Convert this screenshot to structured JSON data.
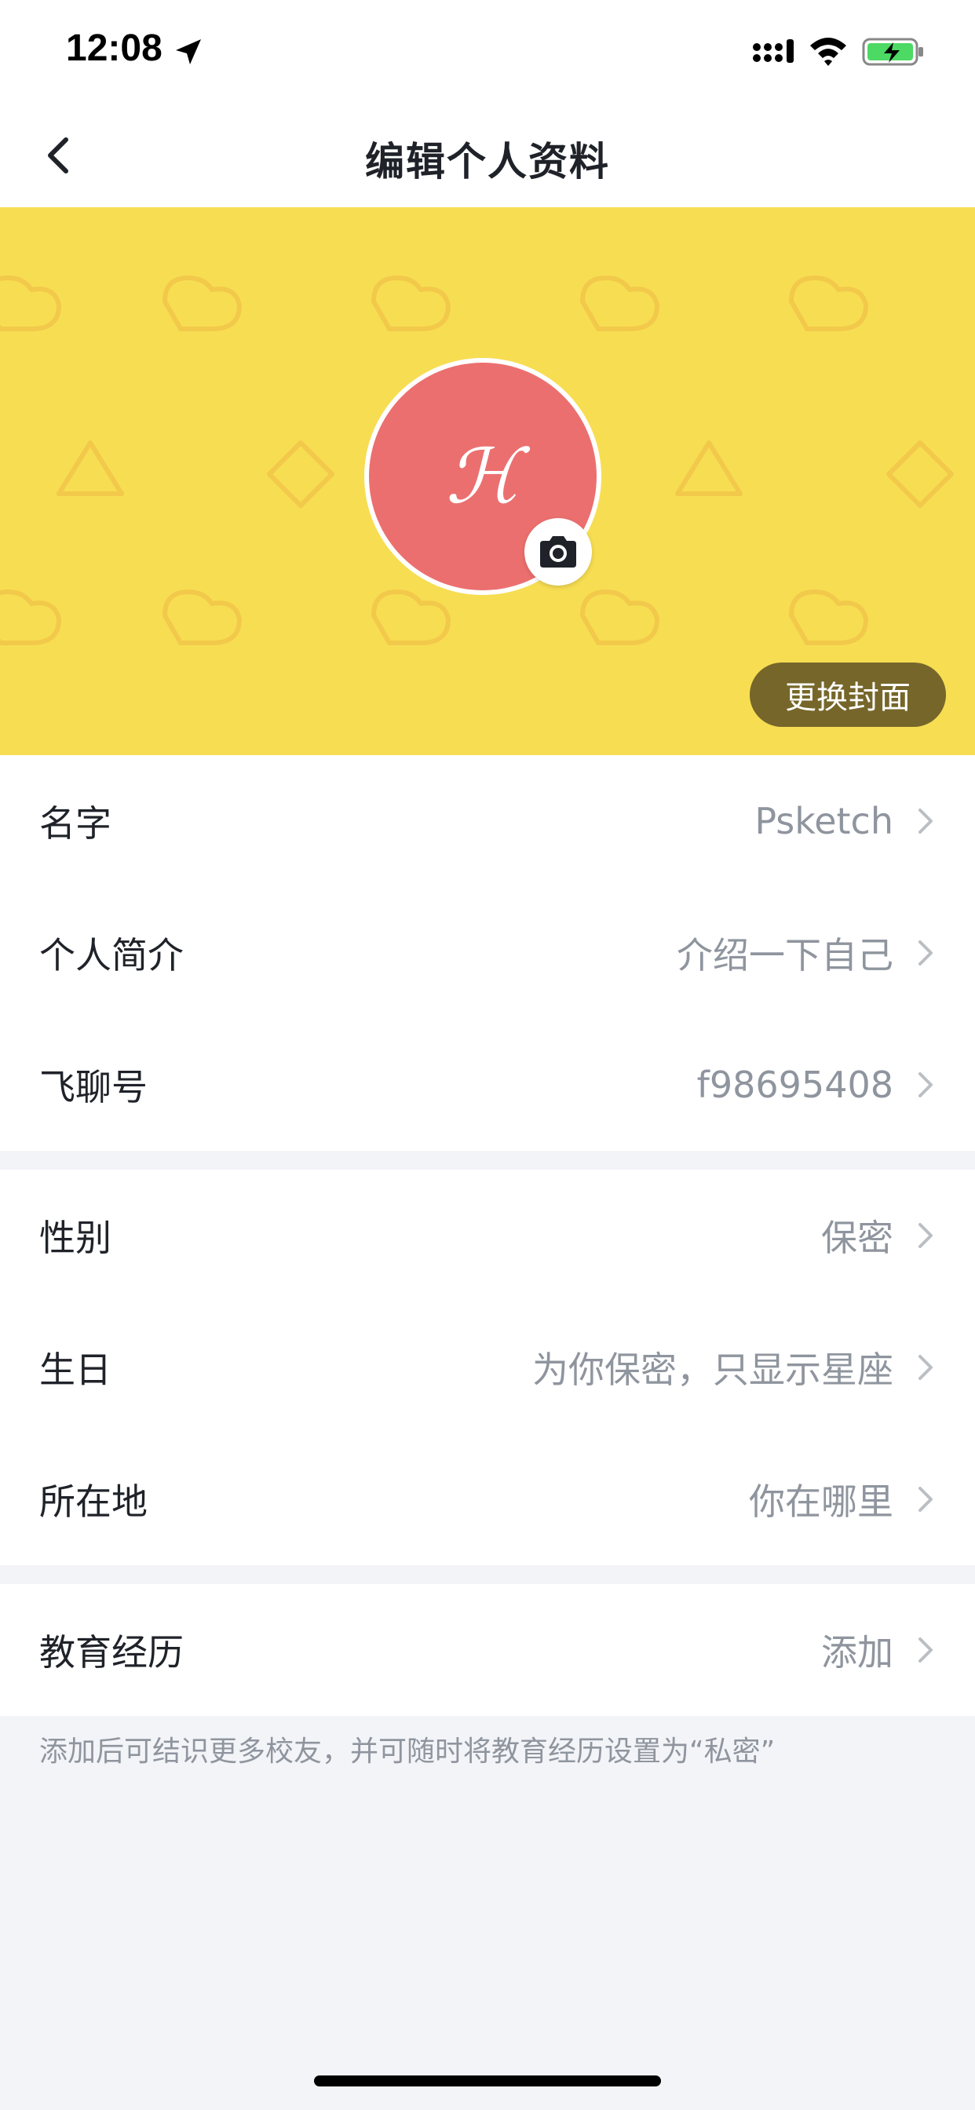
{
  "status_bar": {
    "time": "12:08",
    "icons": [
      "location-arrow-icon",
      "signal-icon",
      "wifi-icon",
      "battery-charging-icon"
    ]
  },
  "nav": {
    "title": "编辑个人资料",
    "back_icon": "chevron-left-icon"
  },
  "cover": {
    "background_color": "#f7dd52",
    "avatar_letter": "ℋ",
    "avatar_color": "#ec6f6f",
    "camera_icon": "camera-icon",
    "change_cover_label": "更换封面"
  },
  "profile_rows": [
    {
      "label": "名字",
      "value": "Psketch"
    },
    {
      "label": "个人简介",
      "value": "介绍一下自己"
    },
    {
      "label": "飞聊号",
      "value": "f98695408"
    }
  ],
  "personal_rows": [
    {
      "label": "性别",
      "value": "保密"
    },
    {
      "label": "生日",
      "value": "为你保密，只显示星座"
    },
    {
      "label": "所在地",
      "value": "你在哪里"
    }
  ],
  "education_rows": [
    {
      "label": "教育经历",
      "value": "添加"
    }
  ],
  "education_hint": "添加后可结识更多校友，并可随时将教育经历设置为“私密”"
}
